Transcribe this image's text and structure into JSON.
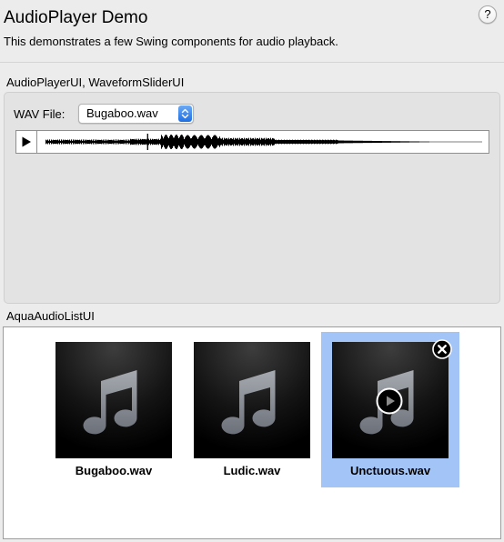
{
  "header": {
    "title": "AudioPlayer Demo",
    "description": "This demonstrates a few Swing components for audio playback.",
    "help_label": "?"
  },
  "player_section": {
    "label": "AudioPlayerUI, WaveformSliderUI",
    "wav_label": "WAV File:",
    "selected_file": "Bugaboo.wav",
    "playhead_fraction": 0.243
  },
  "list_section": {
    "label": "AquaAudioListUI",
    "items": [
      {
        "name": "Bugaboo.wav",
        "selected": false,
        "icon": "music-note-icon"
      },
      {
        "name": "Ludic.wav",
        "selected": false,
        "icon": "music-note-icon"
      },
      {
        "name": "Unctuous.wav",
        "selected": true,
        "icon": "music-note-icon"
      }
    ]
  },
  "colors": {
    "window_background": "#ececec",
    "panel_background": "#e3e3e3",
    "selection": "#a3c4f7",
    "select_arrow_blue": "#1f6fe3"
  }
}
